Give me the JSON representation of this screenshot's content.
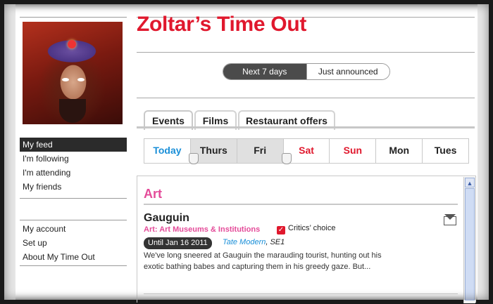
{
  "sidebar": {
    "nav_primary": [
      {
        "label": "My feed",
        "active": true
      },
      {
        "label": "I'm following"
      },
      {
        "label": "I'm attending"
      },
      {
        "label": "My friends"
      }
    ],
    "nav_secondary": [
      {
        "label": "My account"
      },
      {
        "label": "Set up"
      },
      {
        "label": "About My Time Out"
      }
    ]
  },
  "header": {
    "title": "Zoltar’s Time Out",
    "title_color": "#e0182d"
  },
  "toggle": {
    "options": [
      "Next 7 days",
      "Just announced"
    ],
    "selected": "Next 7 days"
  },
  "tabs": [
    {
      "label": "Events",
      "active": true
    },
    {
      "label": "Films"
    },
    {
      "label": "Restaurant offers"
    }
  ],
  "days": [
    {
      "label": "Today",
      "style": "today"
    },
    {
      "label": "Thurs",
      "selected": true
    },
    {
      "label": "Fri",
      "selected": true
    },
    {
      "label": "Sat",
      "style": "weekend"
    },
    {
      "label": "Sun",
      "style": "weekend"
    },
    {
      "label": "Mon"
    },
    {
      "label": "Tues"
    }
  ],
  "content": {
    "section_title": "Art",
    "event": {
      "title": "Gauguin",
      "category": "Art: Art Museums & Institutions",
      "critics_choice": "Critics’ choice",
      "until": "Until Jan 16 2011",
      "venue": "Tate Modern",
      "area": ", SE1",
      "description": "We've long sneered at Gauguin the marauding tourist, hunting out his exotic bathing babes and capturing them in his greedy gaze. But..."
    }
  },
  "colors": {
    "accent_red": "#e0182d",
    "accent_pink": "#e44b99",
    "accent_blue": "#1a8fd8"
  },
  "icons": {
    "critics_check": "check-icon",
    "email": "mail-icon",
    "scroll_up": "scroll-up-icon"
  }
}
